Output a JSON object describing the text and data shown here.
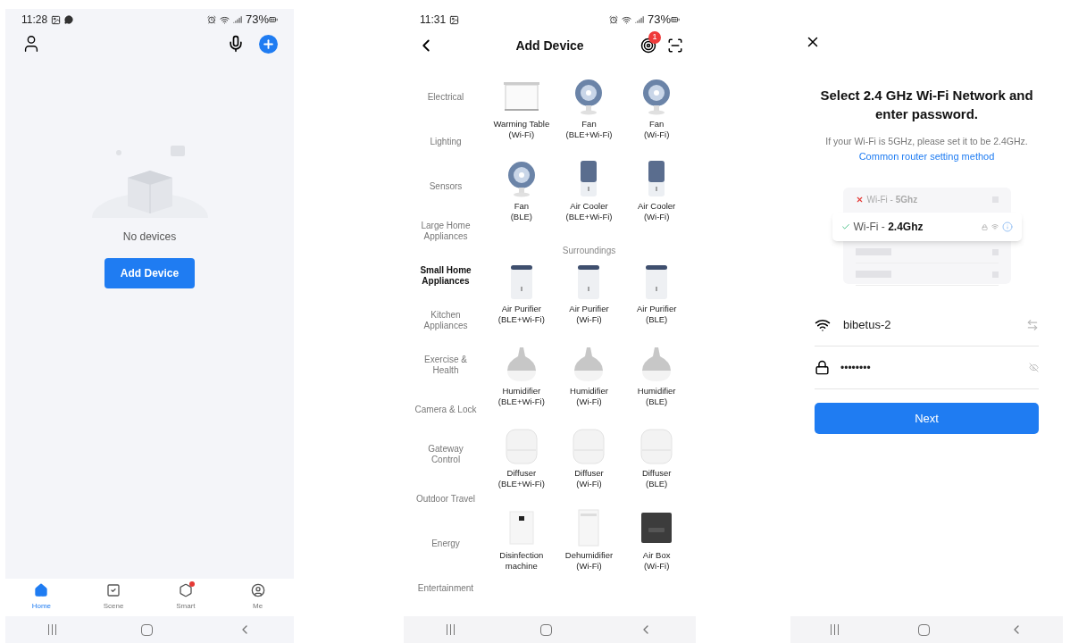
{
  "home_screen": {
    "status_bar": {
      "time": "11:28",
      "battery": "73%"
    },
    "empty_state": {
      "message": "No devices",
      "button": "Add Device"
    },
    "tabs": [
      {
        "label": "Home",
        "selected": true,
        "dot": false
      },
      {
        "label": "Scene",
        "selected": false,
        "dot": false
      },
      {
        "label": "Smart",
        "selected": false,
        "dot": true
      },
      {
        "label": "Me",
        "selected": false,
        "dot": false
      }
    ]
  },
  "add_device_screen": {
    "status_bar": {
      "time": "11:31",
      "battery": "73%"
    },
    "title": "Add Device",
    "badge": "1",
    "categories": [
      {
        "label": "Electrical",
        "selected": false
      },
      {
        "label": "Lighting",
        "selected": false
      },
      {
        "label": "Sensors",
        "selected": false
      },
      {
        "label": "Large Home Appliances",
        "selected": false
      },
      {
        "label": "Small Home Appliances",
        "selected": true
      },
      {
        "label": "Kitchen Appliances",
        "selected": false
      },
      {
        "label": "Exercise & Health",
        "selected": false
      },
      {
        "label": "Camera & Lock",
        "selected": false
      },
      {
        "label": "Gateway Control",
        "selected": false
      },
      {
        "label": "Outdoor Travel",
        "selected": false
      },
      {
        "label": "Energy",
        "selected": false
      },
      {
        "label": "Entertainment",
        "selected": false
      }
    ],
    "sections": [
      {
        "devices": [
          {
            "kind": "table",
            "name": "Warming Table",
            "protocol": "(Wi-Fi)"
          },
          {
            "kind": "fan",
            "name": "Fan",
            "protocol": "(BLE+Wi-Fi)"
          },
          {
            "kind": "fan",
            "name": "Fan",
            "protocol": "(Wi-Fi)"
          },
          {
            "kind": "fan",
            "name": "Fan",
            "protocol": "(BLE)"
          },
          {
            "kind": "cooler",
            "name": "Air Cooler",
            "protocol": "(BLE+Wi-Fi)"
          },
          {
            "kind": "cooler",
            "name": "Air Cooler",
            "protocol": "(Wi-Fi)"
          }
        ]
      },
      {
        "heading": "Surroundings",
        "devices": [
          {
            "kind": "purifier",
            "name": "Air Purifier",
            "protocol": "(BLE+Wi-Fi)"
          },
          {
            "kind": "purifier",
            "name": "Air Purifier",
            "protocol": "(Wi-Fi)"
          },
          {
            "kind": "purifier",
            "name": "Air Purifier",
            "protocol": "(BLE)"
          },
          {
            "kind": "humidifier",
            "name": "Humidifier",
            "protocol": "(BLE+Wi-Fi)"
          },
          {
            "kind": "humidifier",
            "name": "Humidifier",
            "protocol": "(Wi-Fi)"
          },
          {
            "kind": "humidifier",
            "name": "Humidifier",
            "protocol": "(BLE)"
          },
          {
            "kind": "diffuser",
            "name": "Diffuser",
            "protocol": "(BLE+Wi-Fi)"
          },
          {
            "kind": "diffuser",
            "name": "Diffuser",
            "protocol": "(Wi-Fi)"
          },
          {
            "kind": "diffuser",
            "name": "Diffuser",
            "protocol": "(BLE)"
          },
          {
            "kind": "disinfection",
            "name": "Disinfection machine"
          },
          {
            "kind": "dehumidifier",
            "name": "Dehumidifier",
            "protocol": "(Wi-Fi)"
          },
          {
            "kind": "airbox",
            "name": "Air Box",
            "protocol": "(Wi-Fi)"
          }
        ]
      }
    ]
  },
  "wifi_screen": {
    "heading": "Select 2.4 GHz Wi-Fi Network and enter password.",
    "hint": "If your Wi-Fi is 5GHz, please set it to be 2.4GHz.",
    "link": "Common router setting method",
    "example_networks": [
      {
        "kind": "rejected",
        "prefix": "Wi-Fi - ",
        "band": "5Ghz"
      },
      {
        "kind": "accepted",
        "prefix": "Wi-Fi - ",
        "band": "2.4Ghz"
      }
    ],
    "network_name": "bibetus-2",
    "password": "••••••••",
    "button": "Next"
  }
}
